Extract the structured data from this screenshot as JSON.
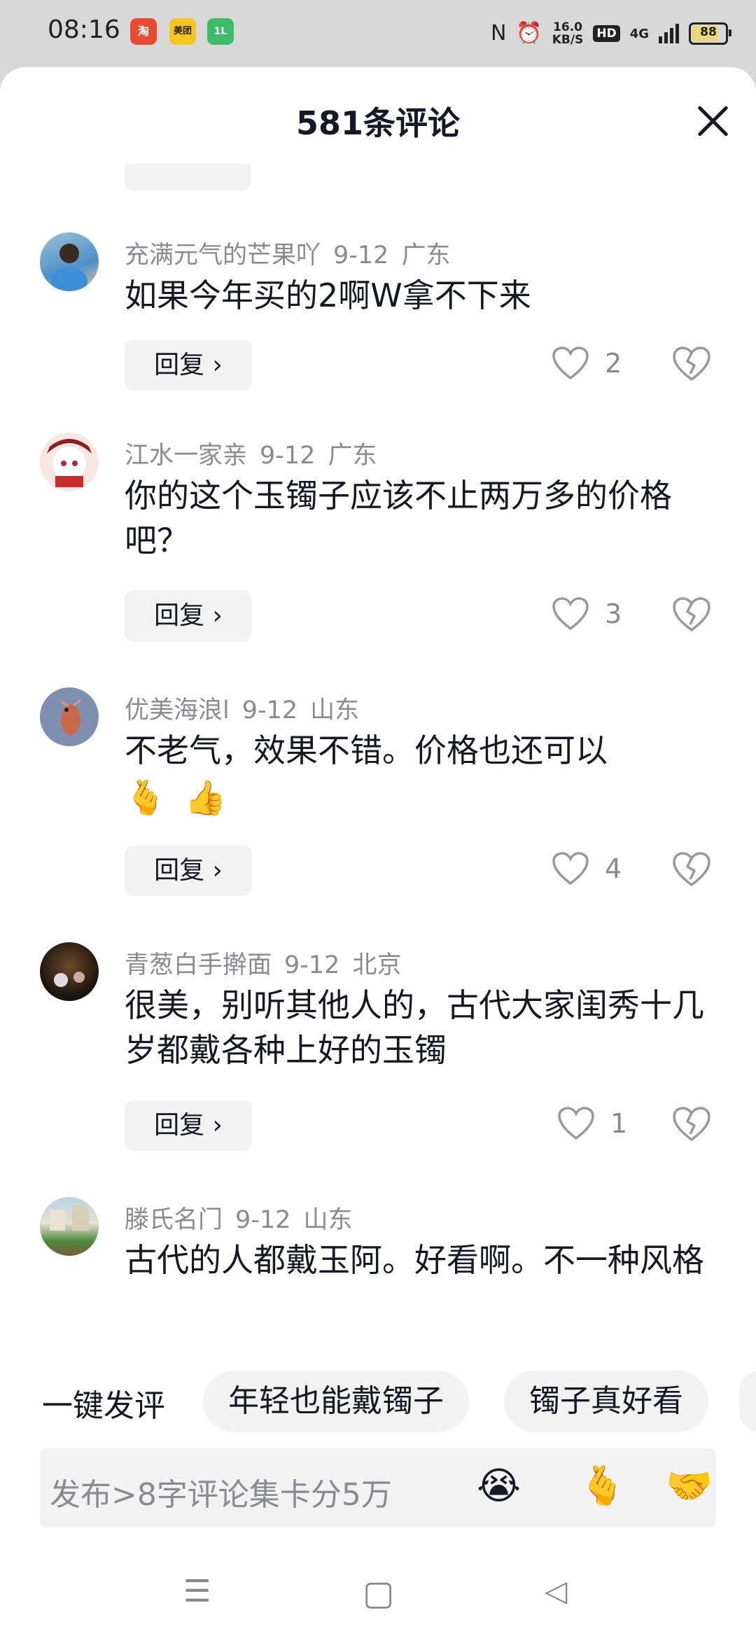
{
  "status_bar": {
    "time": "08:16",
    "apps": [
      {
        "name": "taobao-icon",
        "label": "淘",
        "color": "#e94a33"
      },
      {
        "name": "meituan-icon",
        "label": "美团",
        "color": "#f7c51c"
      },
      {
        "name": "green-app-icon",
        "label": "1L",
        "color": "#3dbd6a"
      }
    ],
    "speed_value": "16.0",
    "speed_unit": "KB/S",
    "hd": "HD",
    "network": "4G",
    "battery": "88",
    "battery_level": 0.88
  },
  "sheet": {
    "title": "581条评论",
    "close_icon": "close-icon"
  },
  "comments": [
    {
      "user": "充满元气的芒果吖",
      "date": "9-12",
      "location": "广东",
      "text": "如果今年买的2啊W拿不下来",
      "reply_label": "回复 ›",
      "likes": "2"
    },
    {
      "user": "江水一家亲",
      "date": "9-12",
      "location": "广东",
      "text": "你的这个玉镯子应该不止两万多的价格吧？",
      "reply_label": "回复 ›",
      "likes": "3"
    },
    {
      "user": "优美海浪l",
      "date": "9-12",
      "location": "山东",
      "text": "不老气，效果不错。价格也还可以",
      "emojis": [
        "🫰",
        "👍"
      ],
      "reply_label": "回复 ›",
      "likes": "4"
    },
    {
      "user": "青葱白手擀面",
      "date": "9-12",
      "location": "北京",
      "text": "很美，别听其他人的，古代大家闺秀十几岁都戴各种上好的玉镯",
      "reply_label": "回复 ›",
      "likes": "1"
    },
    {
      "user": "滕氏名门",
      "date": "9-12",
      "location": "山东",
      "text": "古代的人都戴玉阿。好看啊。不一种风格"
    }
  ],
  "quick_comment": {
    "label": "一键发评",
    "chips": [
      "年轻也能戴镯子",
      "镯子真好看"
    ]
  },
  "input": {
    "placeholder": "发布>8字评论集卡分5万",
    "emojis": [
      "😭",
      "🫰",
      "🤝"
    ]
  },
  "nav": {
    "menu": "☰",
    "home": "▢",
    "back": "◁"
  }
}
